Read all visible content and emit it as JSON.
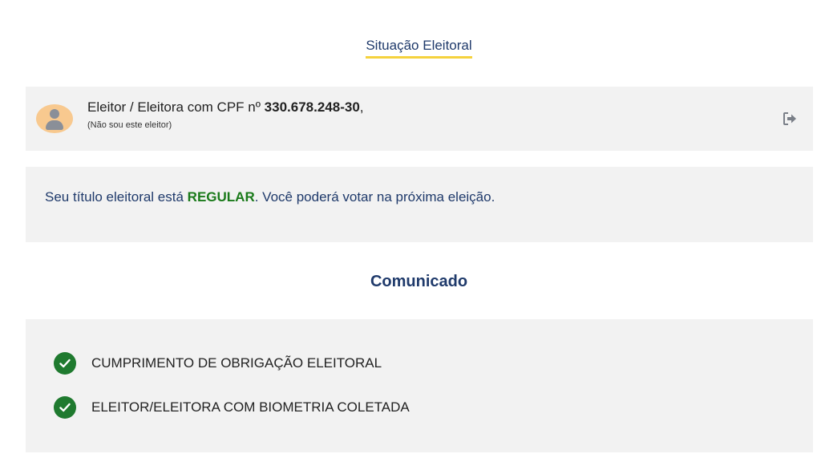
{
  "tab": {
    "title": "Situação Eleitoral"
  },
  "voter": {
    "prefix": "Eleitor / Eleitora com CPF nº ",
    "cpf": "330.678.248-30",
    "suffix": ",",
    "not_me": "(Não sou este eleitor)"
  },
  "status": {
    "prefix": "Seu título eleitoral está ",
    "value": "REGULAR",
    "suffix": ". Você poderá votar na próxima eleição."
  },
  "notices": {
    "title": "Comunicado",
    "items": [
      {
        "label": "CUMPRIMENTO DE OBRIGAÇÃO ELEITORAL"
      },
      {
        "label": "ELEITOR/ELEITORA COM BIOMETRIA COLETADA"
      }
    ]
  },
  "colors": {
    "accent_underline": "#f5d23d",
    "heading_blue": "#1f3a6b",
    "regular_green": "#1a7a1a",
    "check_green": "#1f7a2f",
    "panel_bg": "#f2f2f2",
    "avatar_bg": "#f8c98f"
  },
  "icons": {
    "avatar": "user-avatar-icon",
    "logout": "sign-out-icon",
    "check": "check-circle-icon"
  }
}
